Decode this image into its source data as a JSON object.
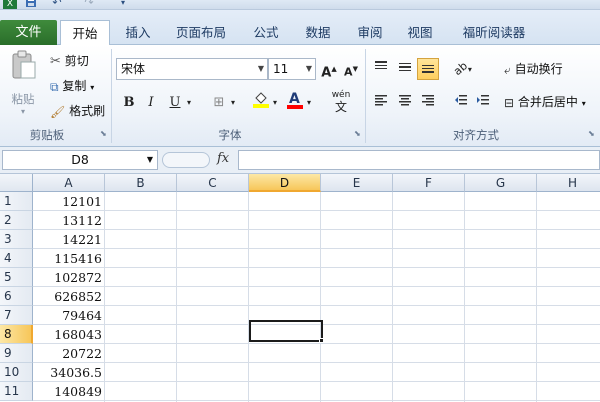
{
  "quick_access": {
    "icons": [
      "excel-logo-icon",
      "save-icon",
      "undo-icon",
      "redo-icon",
      "customize-icon"
    ]
  },
  "tabs": {
    "file": "文件",
    "items": [
      "开始",
      "插入",
      "页面布局",
      "公式",
      "数据",
      "审阅",
      "视图",
      "福昕阅读器"
    ],
    "active_index": 0
  },
  "clipboard": {
    "paste": "粘贴",
    "cut": "剪切",
    "copy": "复制",
    "format_painter": "格式刷",
    "group_label": "剪贴板"
  },
  "font": {
    "name": "宋体",
    "size": "11",
    "bold": "B",
    "italic": "I",
    "underline": "U",
    "grow": "A",
    "shrink": "A",
    "phonetic": "wén",
    "phonetic_char": "文",
    "group_label": "字体",
    "fill_color": "#ffff00",
    "font_color": "#ff0000"
  },
  "alignment": {
    "wrap_text": "自动换行",
    "merge_center": "合并后居中",
    "group_label": "对齐方式"
  },
  "formula_bar": {
    "name_box": "D8",
    "fx": "fx",
    "formula": ""
  },
  "sheet": {
    "columns": [
      "A",
      "B",
      "C",
      "D",
      "E",
      "F",
      "G",
      "H"
    ],
    "active_column": "D",
    "active_row": 8,
    "rows": [
      {
        "num": "1",
        "a": "12101"
      },
      {
        "num": "2",
        "a": "13112"
      },
      {
        "num": "3",
        "a": "14221"
      },
      {
        "num": "4",
        "a": "115416"
      },
      {
        "num": "5",
        "a": "102872"
      },
      {
        "num": "6",
        "a": "626852"
      },
      {
        "num": "7",
        "a": "79464"
      },
      {
        "num": "8",
        "a": "168043"
      },
      {
        "num": "9",
        "a": "20722"
      },
      {
        "num": "10",
        "a": "34036.5"
      },
      {
        "num": "11",
        "a": "140849"
      }
    ]
  },
  "colors": {
    "file_tab": "#2a6e2a",
    "active_header": "#f7c65a",
    "selection_border": "#1b1b1b"
  }
}
